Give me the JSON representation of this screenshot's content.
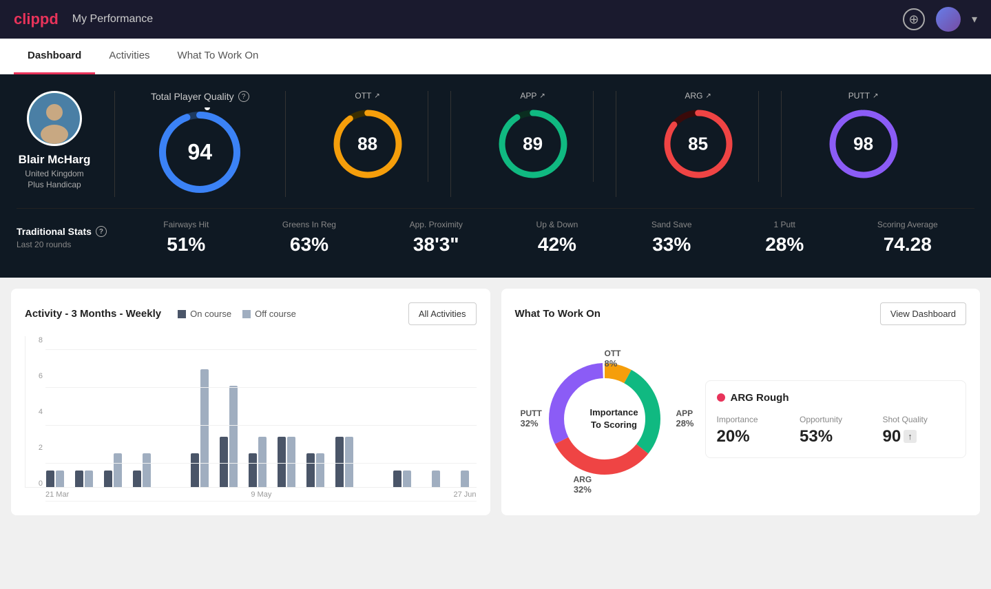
{
  "header": {
    "logo": "clippd",
    "title": "My Performance",
    "add_btn_label": "+",
    "avatar_label": "User"
  },
  "nav": {
    "tabs": [
      {
        "label": "Dashboard",
        "active": true
      },
      {
        "label": "Activities",
        "active": false
      },
      {
        "label": "What To Work On",
        "active": false
      }
    ]
  },
  "player": {
    "name": "Blair McHarg",
    "country": "United Kingdom",
    "handicap": "Plus Handicap"
  },
  "total_quality": {
    "label": "Total Player Quality",
    "score": "94",
    "color": "#3b82f6"
  },
  "scores": [
    {
      "label": "OTT",
      "value": "88",
      "color": "#f59e0b"
    },
    {
      "label": "APP",
      "value": "89",
      "color": "#10b981"
    },
    {
      "label": "ARG",
      "value": "85",
      "color": "#ef4444"
    },
    {
      "label": "PUTT",
      "value": "98",
      "color": "#8b5cf6"
    }
  ],
  "trad_stats": {
    "title": "Traditional Stats",
    "subtitle": "Last 20 rounds",
    "items": [
      {
        "label": "Fairways Hit",
        "value": "51%"
      },
      {
        "label": "Greens In Reg",
        "value": "63%"
      },
      {
        "label": "App. Proximity",
        "value": "38'3\""
      },
      {
        "label": "Up & Down",
        "value": "42%"
      },
      {
        "label": "Sand Save",
        "value": "33%"
      },
      {
        "label": "1 Putt",
        "value": "28%"
      },
      {
        "label": "Scoring Average",
        "value": "74.28"
      }
    ]
  },
  "activity_chart": {
    "title": "Activity - 3 Months - Weekly",
    "legend_oncourse": "On course",
    "legend_offcourse": "Off course",
    "all_activities_btn": "All Activities",
    "x_labels": [
      "21 Mar",
      "9 May",
      "27 Jun"
    ],
    "y_labels": [
      "0",
      "2",
      "4",
      "6",
      "8"
    ],
    "bars": [
      {
        "on": 1,
        "off": 1
      },
      {
        "on": 1,
        "off": 1
      },
      {
        "on": 1,
        "off": 2
      },
      {
        "on": 1,
        "off": 2
      },
      {
        "on": 0,
        "off": 0
      },
      {
        "on": 2,
        "off": 7
      },
      {
        "on": 3,
        "off": 6
      },
      {
        "on": 2,
        "off": 3
      },
      {
        "on": 3,
        "off": 3
      },
      {
        "on": 2,
        "off": 2
      },
      {
        "on": 3,
        "off": 3
      },
      {
        "on": 0,
        "off": 0
      },
      {
        "on": 1,
        "off": 1
      },
      {
        "on": 0,
        "off": 1
      },
      {
        "on": 0,
        "off": 1
      }
    ]
  },
  "what_to_work_on": {
    "title": "What To Work On",
    "view_btn": "View Dashboard",
    "donut_center": "Importance\nTo Scoring",
    "segments": [
      {
        "label": "OTT",
        "value": "8%",
        "color": "#f59e0b",
        "angle": 29
      },
      {
        "label": "APP",
        "value": "28%",
        "color": "#10b981",
        "angle": 101
      },
      {
        "label": "ARG",
        "value": "32%",
        "color": "#ef4444",
        "angle": 115
      },
      {
        "label": "PUTT",
        "value": "32%",
        "color": "#8b5cf6",
        "angle": 115
      }
    ],
    "card": {
      "title": "ARG Rough",
      "dot_color": "#e8335a",
      "metrics": [
        {
          "label": "Importance",
          "value": "20%"
        },
        {
          "label": "Opportunity",
          "value": "53%"
        },
        {
          "label": "Shot Quality",
          "value": "90"
        }
      ]
    }
  }
}
